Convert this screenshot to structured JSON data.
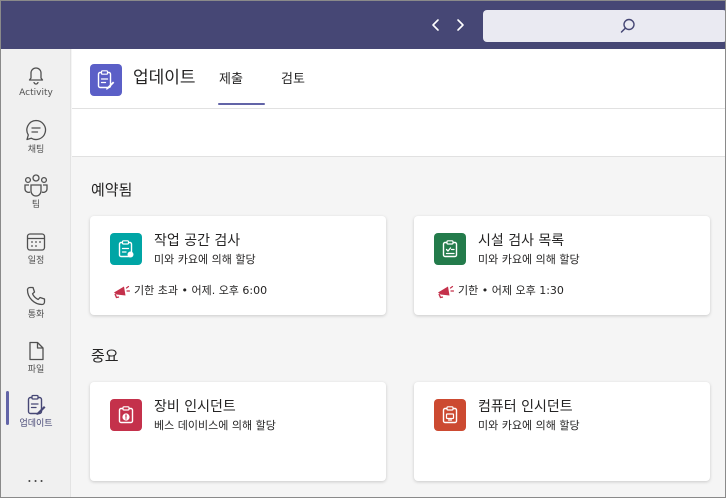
{
  "colors": {
    "titlebar": "#464775",
    "brand": "#6264a7",
    "app_logo": "#5b5fc7",
    "teal": "#00a5a5",
    "green": "#237b4b",
    "red": "#c4314b",
    "orange": "#cc4a31"
  },
  "titlebar": {
    "back_icon": "chevron-left-icon",
    "forward_icon": "chevron-right-icon",
    "search_icon": "search-icon"
  },
  "rail": {
    "items": [
      {
        "label": "Activity",
        "icon": "bell-icon"
      },
      {
        "label": "채팅",
        "icon": "chat-icon"
      },
      {
        "label": "팀",
        "icon": "teams-icon"
      },
      {
        "label": "일정",
        "icon": "calendar-icon"
      },
      {
        "label": "통화",
        "icon": "phone-icon"
      },
      {
        "label": "파일",
        "icon": "file-icon"
      },
      {
        "label": "업데이트",
        "icon": "updates-icon"
      }
    ],
    "more": "..."
  },
  "header": {
    "title": "업데이트",
    "tabs": [
      {
        "label": "제출",
        "active": true
      },
      {
        "label": "검토",
        "active": false
      }
    ]
  },
  "sections": [
    {
      "heading": "예약됨",
      "cards": [
        {
          "title": "작업 공간 검사",
          "subtitle": "미와 카요에 의해 할당",
          "meta": "기한 초과 • 어제. 오후 6:00",
          "icon": "clipboard-icon"
        },
        {
          "title": "시설 검사 목록",
          "subtitle": "미와 카요에 의해 할당",
          "meta": "기한 • 어제 오후 1:30",
          "icon": "checklist-icon"
        }
      ]
    },
    {
      "heading": "중요",
      "cards": [
        {
          "title": "장비 인시던트",
          "subtitle": "베스 데이비스에 의해 할당",
          "icon": "alert-clipboard-icon"
        },
        {
          "title": "컴퓨터 인시던트",
          "subtitle": "미와 카요에 의해 할당",
          "icon": "computer-clipboard-icon"
        }
      ]
    }
  ]
}
